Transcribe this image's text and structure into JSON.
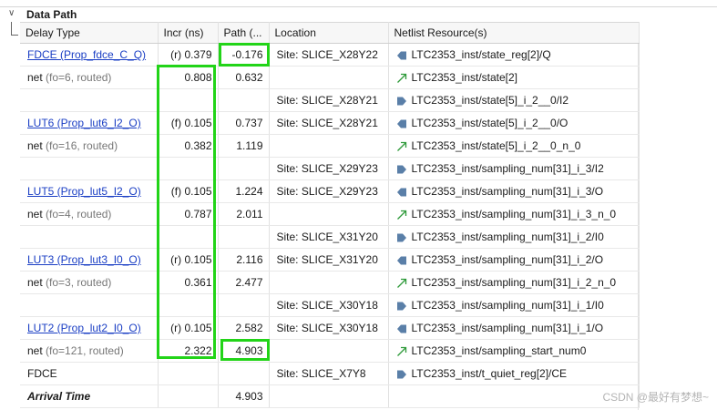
{
  "section": {
    "title": "Data Path"
  },
  "columns": [
    "Delay Type",
    "Incr (ns)",
    "Path (...",
    "Location",
    "Netlist Resource(s)"
  ],
  "rows": [
    {
      "type": "link",
      "delay": "FDCE (Prop_fdce_C_Q)",
      "incr_prefix": "(r)",
      "incr": "0.379",
      "path": "-0.176",
      "location": "Site: SLICE_X28Y22",
      "resource": "LTC2353_inst/state_reg[2]/Q",
      "icon": "pin-left-icon"
    },
    {
      "type": "net",
      "delay": "net",
      "fo": "(fo=6, routed)",
      "incr_prefix": "",
      "incr": "0.808",
      "path": "0.632",
      "location": "",
      "resource": "LTC2353_inst/state[2]",
      "icon": "net-arrow-icon"
    },
    {
      "type": "site",
      "delay": "",
      "fo": "",
      "incr_prefix": "",
      "incr": "",
      "path": "",
      "location": "Site: SLICE_X28Y21",
      "resource": "LTC2353_inst/state[5]_i_2__0/I2",
      "icon": "pin-right-icon"
    },
    {
      "type": "link",
      "delay": "LUT6 (Prop_lut6_I2_O)",
      "incr_prefix": "(f)",
      "incr": "0.105",
      "path": "0.737",
      "location": "Site: SLICE_X28Y21",
      "resource": "LTC2353_inst/state[5]_i_2__0/O",
      "icon": "pin-left-icon"
    },
    {
      "type": "net",
      "delay": "net",
      "fo": "(fo=16, routed)",
      "incr_prefix": "",
      "incr": "0.382",
      "path": "1.119",
      "location": "",
      "resource": "LTC2353_inst/state[5]_i_2__0_n_0",
      "icon": "net-arrow-icon"
    },
    {
      "type": "site",
      "delay": "",
      "fo": "",
      "incr_prefix": "",
      "incr": "",
      "path": "",
      "location": "Site: SLICE_X29Y23",
      "resource": "LTC2353_inst/sampling_num[31]_i_3/I2",
      "icon": "pin-right-icon"
    },
    {
      "type": "link",
      "delay": "LUT5 (Prop_lut5_I2_O)",
      "incr_prefix": "(f)",
      "incr": "0.105",
      "path": "1.224",
      "location": "Site: SLICE_X29Y23",
      "resource": "LTC2353_inst/sampling_num[31]_i_3/O",
      "icon": "pin-left-icon"
    },
    {
      "type": "net",
      "delay": "net",
      "fo": "(fo=4, routed)",
      "incr_prefix": "",
      "incr": "0.787",
      "path": "2.011",
      "location": "",
      "resource": "LTC2353_inst/sampling_num[31]_i_3_n_0",
      "icon": "net-arrow-icon"
    },
    {
      "type": "site",
      "delay": "",
      "fo": "",
      "incr_prefix": "",
      "incr": "",
      "path": "",
      "location": "Site: SLICE_X31Y20",
      "resource": "LTC2353_inst/sampling_num[31]_i_2/I0",
      "icon": "pin-right-icon"
    },
    {
      "type": "link",
      "delay": "LUT3 (Prop_lut3_I0_O)",
      "incr_prefix": "(r)",
      "incr": "0.105",
      "path": "2.116",
      "location": "Site: SLICE_X31Y20",
      "resource": "LTC2353_inst/sampling_num[31]_i_2/O",
      "icon": "pin-left-icon"
    },
    {
      "type": "net",
      "delay": "net",
      "fo": "(fo=3, routed)",
      "incr_prefix": "",
      "incr": "0.361",
      "path": "2.477",
      "location": "",
      "resource": "LTC2353_inst/sampling_num[31]_i_2_n_0",
      "icon": "net-arrow-icon"
    },
    {
      "type": "site",
      "delay": "",
      "fo": "",
      "incr_prefix": "",
      "incr": "",
      "path": "",
      "location": "Site: SLICE_X30Y18",
      "resource": "LTC2353_inst/sampling_num[31]_i_1/I0",
      "icon": "pin-right-icon"
    },
    {
      "type": "link",
      "delay": "LUT2 (Prop_lut2_I0_O)",
      "incr_prefix": "(r)",
      "incr": "0.105",
      "path": "2.582",
      "location": "Site: SLICE_X30Y18",
      "resource": "LTC2353_inst/sampling_num[31]_i_1/O",
      "icon": "pin-left-icon"
    },
    {
      "type": "net",
      "delay": "net",
      "fo": "(fo=121, routed)",
      "incr_prefix": "",
      "incr": "2.322",
      "path": "4.903",
      "location": "",
      "resource": "LTC2353_inst/sampling_start_num0",
      "icon": "net-arrow-icon"
    },
    {
      "type": "plain",
      "delay": "FDCE",
      "fo": "",
      "incr_prefix": "",
      "incr": "",
      "path": "",
      "location": "Site: SLICE_X7Y8",
      "resource": "LTC2353_inst/t_quiet_reg[2]/CE",
      "icon": "pin-right-icon"
    },
    {
      "type": "arrival",
      "delay": "Arrival Time",
      "fo": "",
      "incr_prefix": "",
      "incr": "",
      "path": "4.903",
      "location": "",
      "resource": "",
      "icon": ""
    }
  ],
  "colors": {
    "highlight": "#22d418",
    "link": "#1a3ec4",
    "pin_icon": "#5a7fa8",
    "net_icon": "#2e9a3a"
  },
  "watermark": "CSDN @最好有梦想~"
}
